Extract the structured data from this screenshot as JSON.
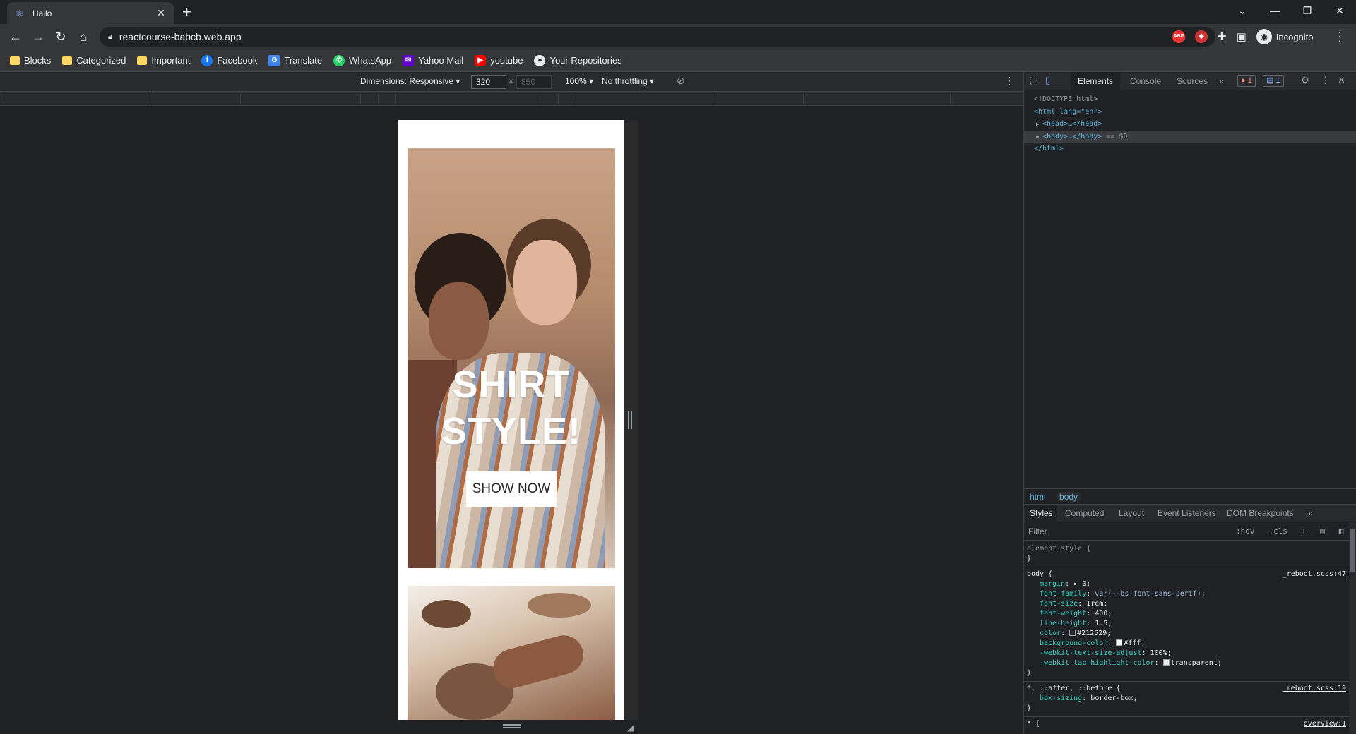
{
  "browser": {
    "tab_title": "Hailo",
    "url": "reactcourse-babcb.web.app",
    "profile_label": "Incognito"
  },
  "bookmarks": [
    {
      "label": "Blocks",
      "icon": "folder-icon"
    },
    {
      "label": "Categorized",
      "icon": "folder-icon"
    },
    {
      "label": "Important",
      "icon": "folder-icon"
    },
    {
      "label": "Facebook",
      "icon": "facebook-icon"
    },
    {
      "label": "Translate",
      "icon": "translate-icon"
    },
    {
      "label": "WhatsApp",
      "icon": "whatsapp-icon"
    },
    {
      "label": "Yahoo Mail",
      "icon": "yahoo-mail-icon"
    },
    {
      "label": "youtube",
      "icon": "youtube-icon"
    },
    {
      "label": "Your Repositories",
      "icon": "github-icon"
    }
  ],
  "device_toolbar": {
    "dimensions_label": "Dimensions: Responsive",
    "width": "320",
    "height": "850",
    "zoom": "100%",
    "throttling": "No throttling"
  },
  "page": {
    "hero_title_line1": "SHIRT",
    "hero_title_line2": "STYLE!",
    "hero_button": "SHOW NOW"
  },
  "devtools": {
    "tabs": [
      "Elements",
      "Console",
      "Sources"
    ],
    "error_count": "1",
    "message_count": "1",
    "dom": {
      "doctype": "<!DOCTYPE html>",
      "html_open": "<html lang=\"en\">",
      "head": "<head>…</head>",
      "body": "<body>…</body>",
      "body_marker": "== $0",
      "html_close": "</html>"
    },
    "breadcrumbs": [
      "html",
      "body"
    ],
    "subtabs": [
      "Styles",
      "Computed",
      "Layout",
      "Event Listeners",
      "DOM Breakpoints"
    ],
    "filter_placeholder": "Filter",
    "hov_label": ":hov",
    "cls_label": ".cls",
    "element_style": "element.style {",
    "body_rule": {
      "selector": "body {",
      "source": "_reboot.scss:47",
      "decls": [
        {
          "name": "margin",
          "value": "▸ 0;"
        },
        {
          "name": "font-family",
          "value": "var(--bs-font-sans-serif);"
        },
        {
          "name": "font-size",
          "value": "1rem;"
        },
        {
          "name": "font-weight",
          "value": "400;"
        },
        {
          "name": "line-height",
          "value": "1.5;"
        },
        {
          "name": "color",
          "value": "#212529;"
        },
        {
          "name": "background-color",
          "value": "#fff;"
        },
        {
          "name": "-webkit-text-size-adjust",
          "value": "100%;"
        },
        {
          "name": "-webkit-tap-highlight-color",
          "value": "transparent;"
        }
      ]
    },
    "universal_rule": {
      "selector": "*, ::after, ::before {",
      "source": "_reboot.scss:19",
      "decl_name": "box-sizing",
      "decl_value": "border-box;"
    },
    "last_rule": {
      "selector": "* {",
      "source": "overview:1"
    },
    "close_brace": "}"
  },
  "colors": {
    "accent": "#8ab4f8",
    "dom_tag": "#5db0d7",
    "css_prop": "#35d4c7"
  }
}
